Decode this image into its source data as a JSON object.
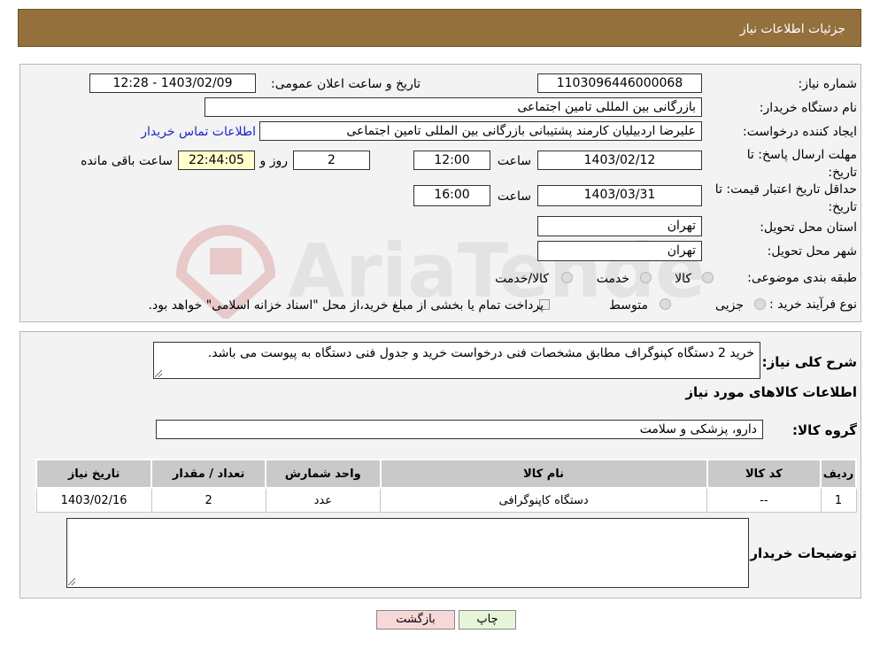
{
  "header": {
    "title": "جزئیات اطلاعات نیاز"
  },
  "form": {
    "need_number_label": "شماره نیاز:",
    "need_number": "1103096446000068",
    "announce_label": "تاریخ و ساعت اعلان عمومی:",
    "announce_value": "1403/02/09 - 12:28",
    "buyer_org_label": "نام دستگاه خریدار:",
    "buyer_org": "بازرگانی بین المللی تامین اجتماعی",
    "creator_label": "ایجاد کننده درخواست:",
    "creator": "علیرضا اردبیلیان کارمند پشتیبانی بازرگانی بین المللی تامین اجتماعی",
    "contact_link": "اطلاعات تماس خریدار",
    "deadline_label": "مهلت ارسال پاسخ: تا تاریخ:",
    "deadline_date": "1403/02/12",
    "time_label": "ساعت",
    "deadline_time": "12:00",
    "days_value": "2",
    "days_label": "روز و",
    "remaining_time": "22:44:05",
    "remaining_label": "ساعت باقی مانده",
    "validity_label": "حداقل تاریخ اعتبار قیمت: تا تاریخ:",
    "validity_date": "1403/03/31",
    "validity_time": "16:00",
    "province_label": "استان محل تحویل:",
    "province": "تهران",
    "city_label": "شهر محل تحویل:",
    "city": "تهران",
    "category_label": "طبقه بندی موضوعی:",
    "category_options": [
      "کالا",
      "خدمت",
      "کالا/خدمت"
    ],
    "process_label": "نوع فرآیند خرید :",
    "process_options": [
      "جزیی",
      "متوسط"
    ],
    "process_note": "پرداخت تمام یا بخشی از مبلغ خرید،از محل \"اسناد خزانه اسلامی\" خواهد بود."
  },
  "details": {
    "description_label": "شرح کلی نیاز:",
    "description": "خرید 2 دستگاه کپنوگراف مطابق مشخصات فنی درخواست خرید و جدول فنی دستگاه به پیوست می باشد.",
    "items_title": "اطلاعات کالاهای مورد نیاز",
    "group_label": "گروه کالا:",
    "group_value": "دارو، پزشکی و سلامت",
    "table_headers": [
      "ردیف",
      "کد کالا",
      "نام کالا",
      "واحد شمارش",
      "تعداد / مقدار",
      "تاریخ نیاز"
    ],
    "rows": [
      [
        "1",
        "--",
        "دستگاه کاپنوگرافی",
        "عدد",
        "2",
        "1403/02/16"
      ]
    ],
    "buyer_notes_label": "توضیحات خریدار:",
    "buyer_notes": ""
  },
  "buttons": {
    "print": "چاپ",
    "back": "بازگشت"
  },
  "watermark": {
    "text": "AriaTender.neT"
  },
  "colors": {
    "header": "#94703d",
    "link": "#1a25c8",
    "yellow": "#ffffcc",
    "back_button": "#f8d7d7",
    "print_button": "#e6f5d8"
  }
}
